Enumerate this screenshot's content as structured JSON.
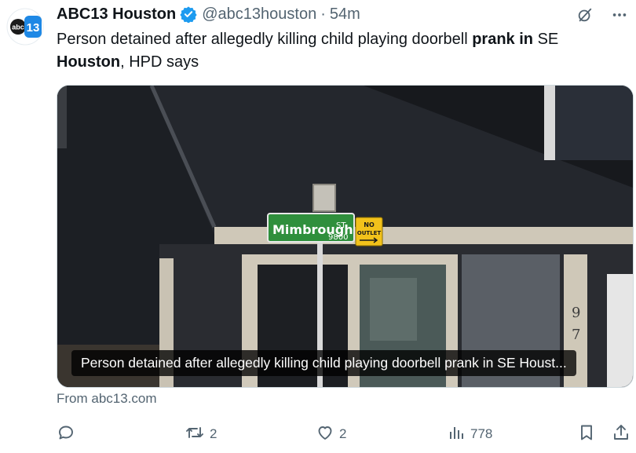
{
  "account": {
    "name": "ABC13 Houston",
    "handle": "@abc13houston",
    "separator": "·",
    "time": "54m"
  },
  "avatar": {
    "logo_text": "abc",
    "logo_number": "13"
  },
  "tweet": {
    "text_part1": "Person detained after allegedly killing child playing doorbell ",
    "text_bold1": "prank in",
    "text_part2": " SE ",
    "text_bold2": "Houston",
    "text_part3": ", HPD says"
  },
  "media": {
    "caption": "Person detained after allegedly killing child playing doorbell prank in SE Houst...",
    "sign_street": "Mimbrough",
    "sign_suffix": "ST",
    "sign_block": "9800",
    "sign_no_outlet_1": "NO",
    "sign_no_outlet_2": "OUTLET",
    "house_number_1": "9",
    "house_number_2": "7"
  },
  "source": "From abc13.com",
  "actions": {
    "replies": "",
    "reposts": "2",
    "likes": "2",
    "views": "778"
  },
  "colors": {
    "verified": "#1d9bf0",
    "muted": "#536471",
    "sign_green": "#2f8f3c",
    "sign_yellow": "#f2c21b"
  },
  "icons": [
    "grok-icon",
    "more-icon",
    "reply-icon",
    "repost-icon",
    "like-icon",
    "views-icon",
    "bookmark-icon",
    "share-icon",
    "verified-badge-icon"
  ]
}
